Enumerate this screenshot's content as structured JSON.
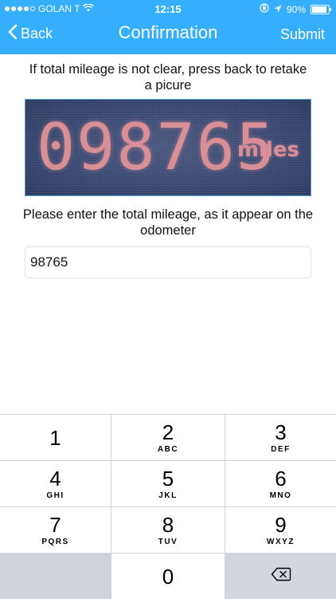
{
  "status_bar": {
    "carrier": "GOLAN T",
    "time": "12:15",
    "battery": "90%",
    "battery_level": 0.9
  },
  "nav": {
    "back_label": "Back",
    "title": "Confirmation",
    "submit_label": "Submit"
  },
  "instruction_text": "If total mileage is not clear, press back to retake a picure",
  "odometer_photo": {
    "digits": "098765",
    "unit": "miles"
  },
  "prompt_text": "Please enter the total mileage, as it appear on the odometer",
  "mileage_input": {
    "value": "98765"
  },
  "keypad": {
    "keys": [
      {
        "num": "1",
        "letters": ""
      },
      {
        "num": "2",
        "letters": "ABC"
      },
      {
        "num": "3",
        "letters": "DEF"
      },
      {
        "num": "4",
        "letters": "GHI"
      },
      {
        "num": "5",
        "letters": "JKL"
      },
      {
        "num": "6",
        "letters": "MNO"
      },
      {
        "num": "7",
        "letters": "PQRS"
      },
      {
        "num": "8",
        "letters": "TUV"
      },
      {
        "num": "9",
        "letters": "WXYZ"
      },
      {
        "num": "0",
        "letters": ""
      }
    ]
  },
  "colors": {
    "accent": "#35aefc",
    "keypad_background": "#cfd3d9"
  }
}
